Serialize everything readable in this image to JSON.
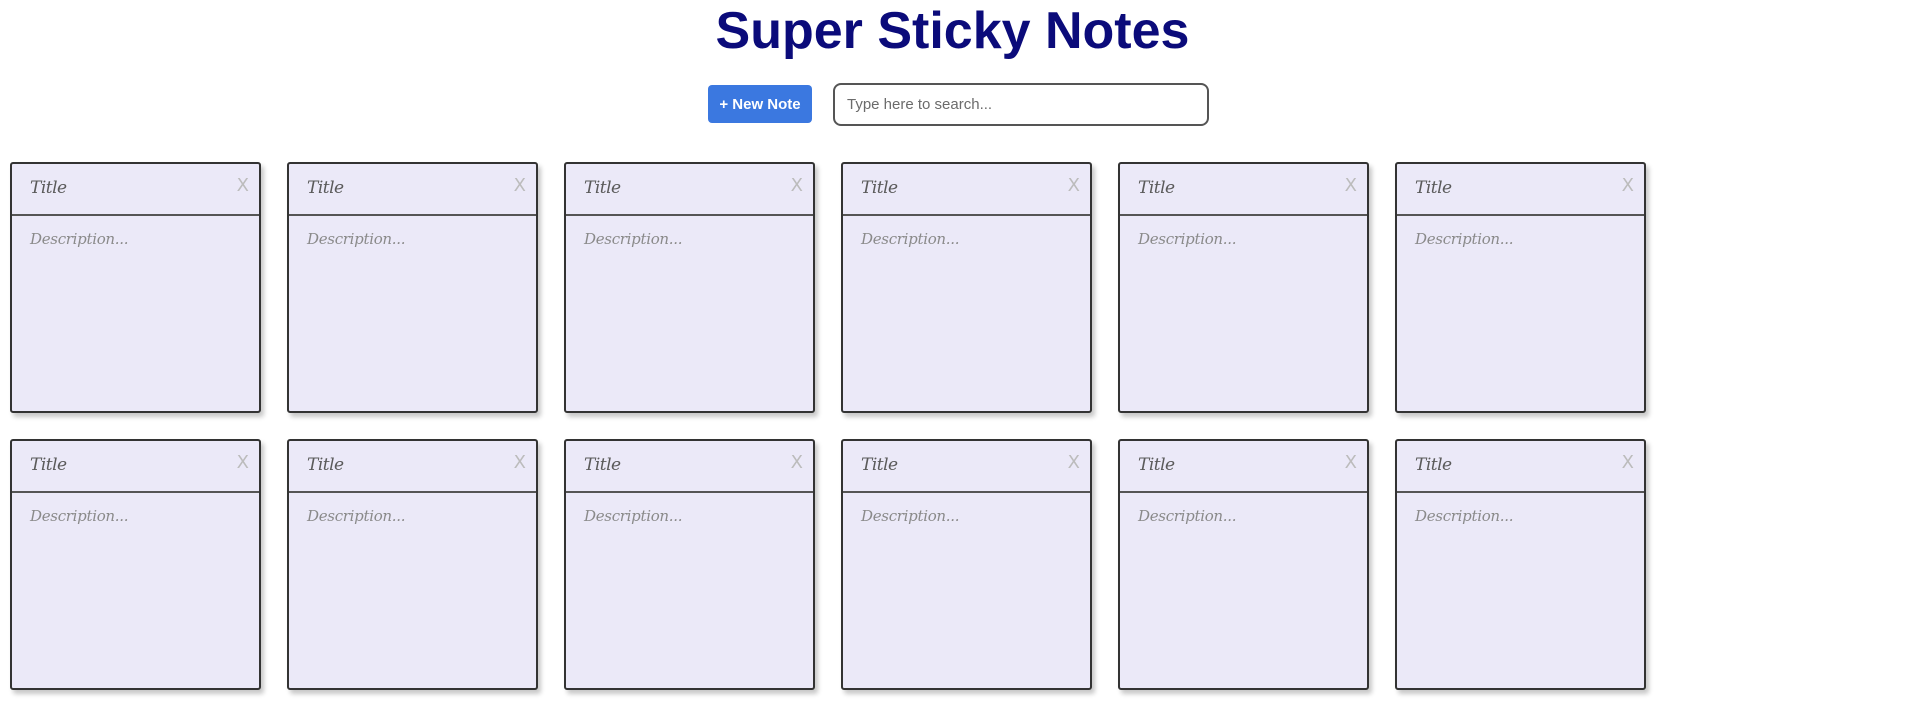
{
  "app": {
    "title": "Super Sticky Notes",
    "title_color": "#0b0b7a"
  },
  "toolbar": {
    "new_note_label": "+ New Note",
    "new_note_color": "#3b78e0",
    "search_value": "",
    "search_placeholder": "Type here to search..."
  },
  "theme": {
    "note_background": "#ebe9f8",
    "close_icon": "close-icon"
  },
  "notes": [
    {
      "title": "Title",
      "description": "Description...",
      "close": "X"
    },
    {
      "title": "Title",
      "description": "Description...",
      "close": "X"
    },
    {
      "title": "Title",
      "description": "Description...",
      "close": "X"
    },
    {
      "title": "Title",
      "description": "Description...",
      "close": "X"
    },
    {
      "title": "Title",
      "description": "Description...",
      "close": "X"
    },
    {
      "title": "Title",
      "description": "Description...",
      "close": "X"
    },
    {
      "title": "Title",
      "description": "Description...",
      "close": "X"
    },
    {
      "title": "Title",
      "description": "Description...",
      "close": "X"
    },
    {
      "title": "Title",
      "description": "Description...",
      "close": "X"
    },
    {
      "title": "Title",
      "description": "Description...",
      "close": "X"
    },
    {
      "title": "Title",
      "description": "Description...",
      "close": "X"
    },
    {
      "title": "Title",
      "description": "Description...",
      "close": "X"
    }
  ]
}
